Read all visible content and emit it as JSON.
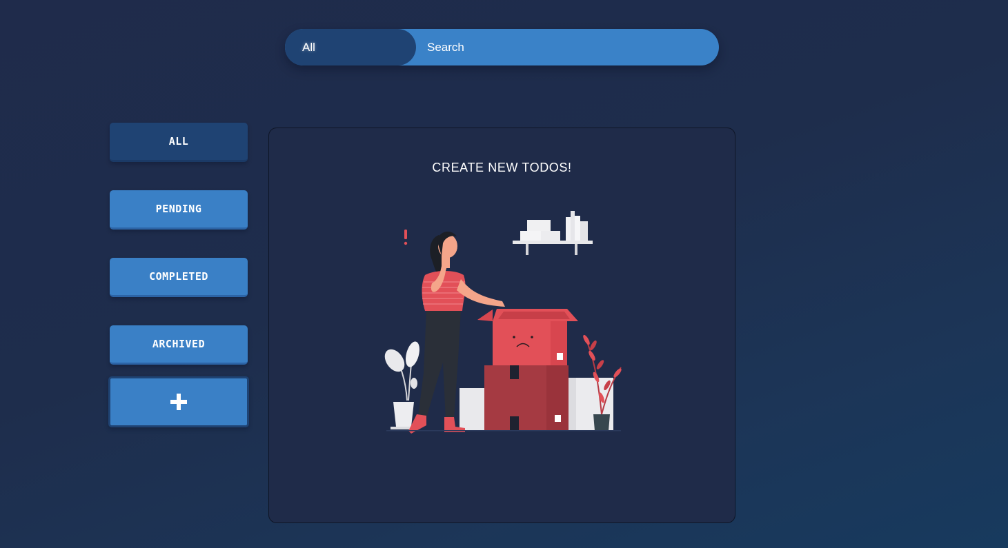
{
  "search": {
    "filter_label": "All",
    "placeholder": "Search",
    "value": ""
  },
  "sidebar": {
    "items": [
      {
        "label": "ALL",
        "active": true
      },
      {
        "label": "PENDING",
        "active": false
      },
      {
        "label": "COMPLETED",
        "active": false
      },
      {
        "label": "ARCHIVED",
        "active": false
      }
    ],
    "add_icon": "plus-icon"
  },
  "main": {
    "empty_title": "CREATE NEW TODOS!",
    "illustration": "empty-box-illustration"
  },
  "colors": {
    "background": "#1f2b4b",
    "accent": "#3a80c6",
    "active": "#1f4373",
    "panel": "#1f2b49",
    "illustration_red": "#e25058"
  }
}
